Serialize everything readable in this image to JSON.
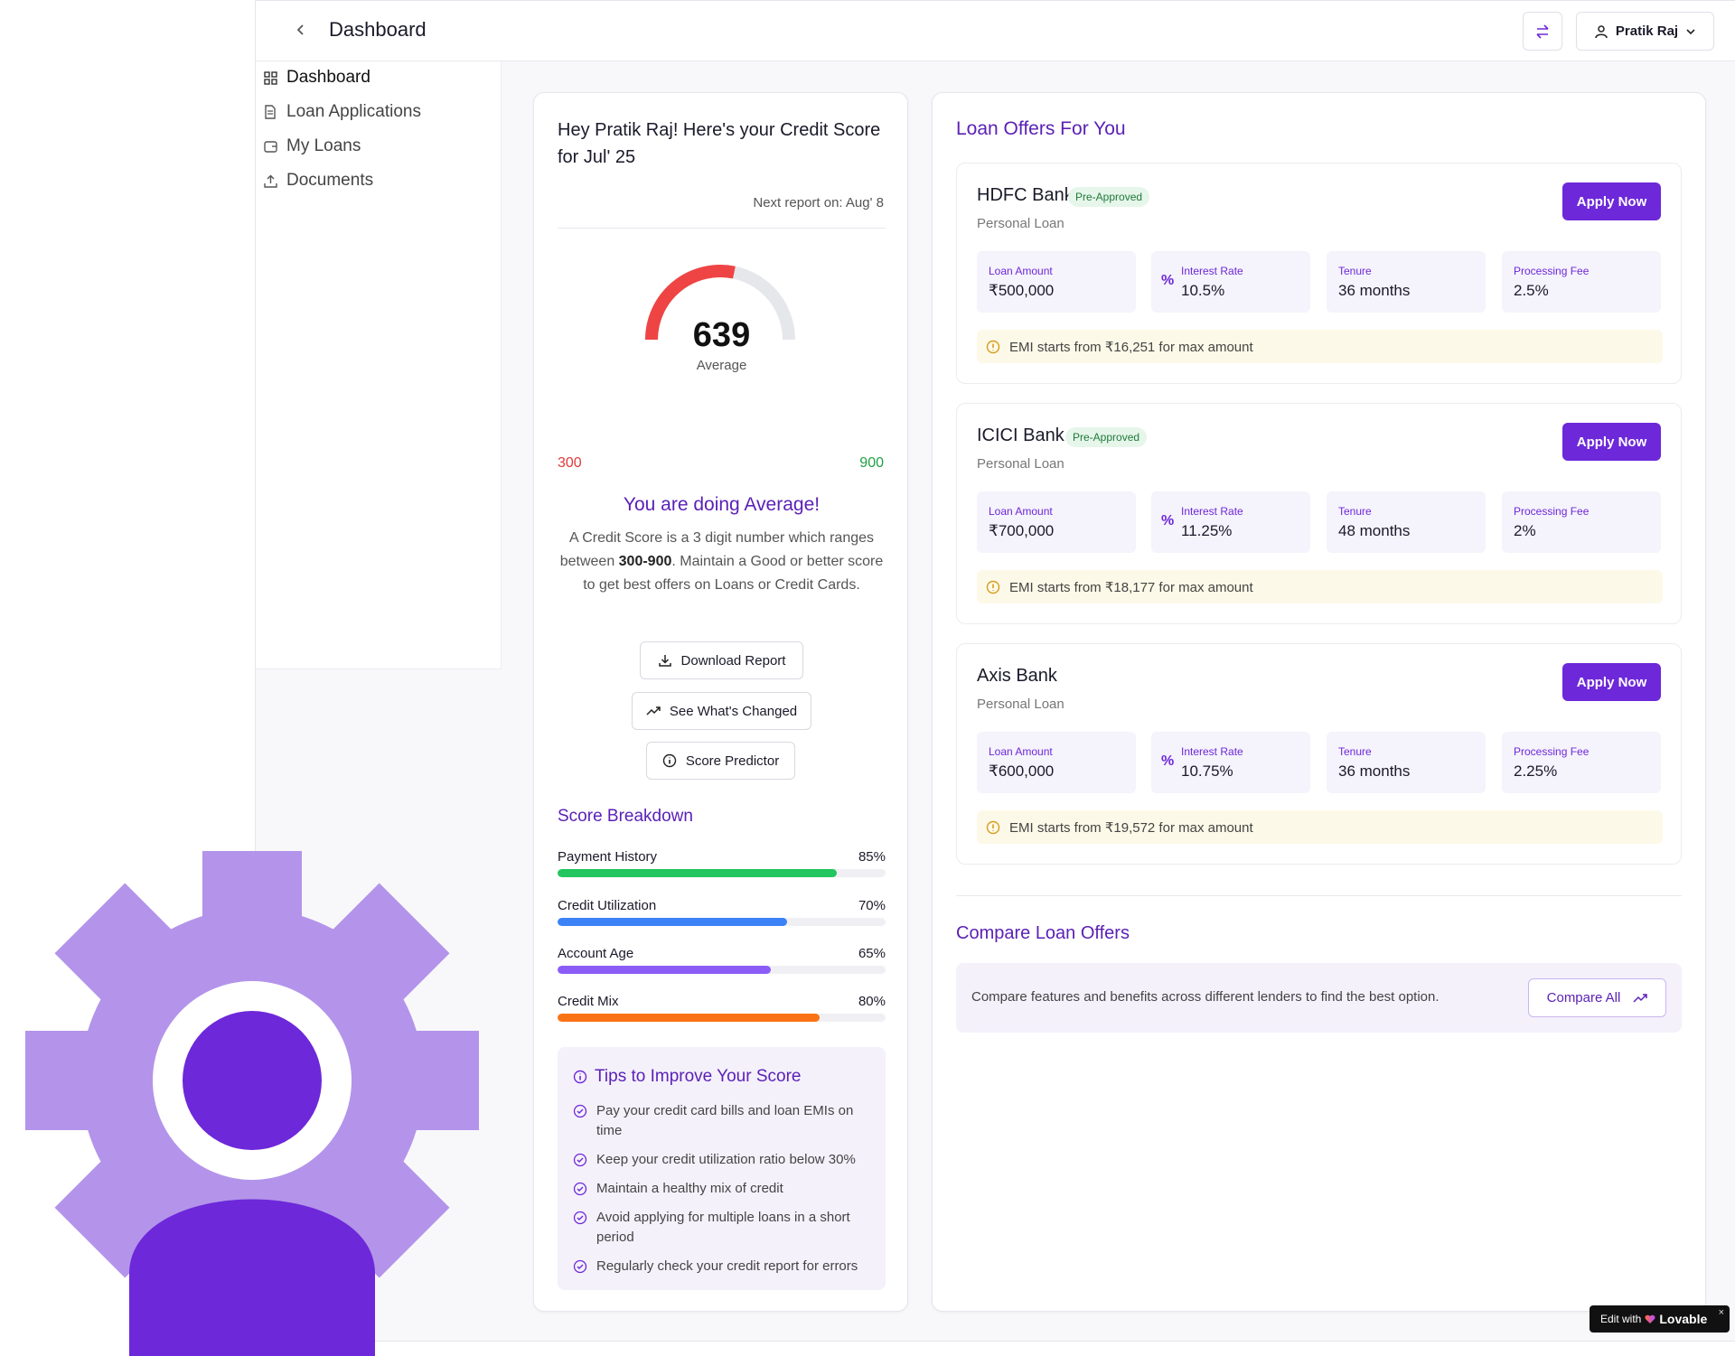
{
  "header": {
    "title": "Dashboard",
    "user_name": "Pratik Raj"
  },
  "sidebar": {
    "items": [
      {
        "label": "Dashboard",
        "icon": "grid-icon"
      },
      {
        "label": "Loan Applications",
        "icon": "file-icon"
      },
      {
        "label": "My Loans",
        "icon": "wallet-icon"
      },
      {
        "label": "Documents",
        "icon": "upload-icon"
      }
    ]
  },
  "credit": {
    "title": "Hey Pratik Raj! Here's your Credit Score for Jul' 25",
    "next_report": "Next report on: Aug' 8",
    "score": "639",
    "score_value": 639,
    "score_label": "Average",
    "range_min": "300",
    "range_max": "900",
    "status": "You are doing Average!",
    "desc_1": "A Credit Score is a 3 digit number which ranges between ",
    "desc_bold": "300-900",
    "desc_2": ". Maintain a Good or better score to get best offers on Loans or Credit Cards.",
    "buttons": {
      "download": "Download Report",
      "changed": "See What's Changed",
      "predictor": "Score Predictor"
    },
    "colors": {
      "gauge_fill": "#ef4444",
      "gauge_track": "#e5e7eb"
    }
  },
  "breakdown": {
    "title": "Score Breakdown",
    "items": [
      {
        "label": "Payment History",
        "pct": "85%",
        "value": 85,
        "color": "#22c55e"
      },
      {
        "label": "Credit Utilization",
        "pct": "70%",
        "value": 70,
        "color": "#3b82f6"
      },
      {
        "label": "Account Age",
        "pct": "65%",
        "value": 65,
        "color": "#8b5cf6"
      },
      {
        "label": "Credit Mix",
        "pct": "80%",
        "value": 80,
        "color": "#f97316"
      }
    ]
  },
  "tips": {
    "title": "Tips to Improve Your Score",
    "items": [
      "Pay your credit card bills and loan EMIs on time",
      "Keep your credit utilization ratio below 30%",
      "Maintain a healthy mix of credit",
      "Avoid applying for multiple loans in a short period",
      "Regularly check your credit report for errors"
    ]
  },
  "offers": {
    "title": "Loan Offers For You",
    "apply_label": "Apply Now",
    "labels": {
      "amount": "Loan Amount",
      "rate": "Interest Rate",
      "tenure": "Tenure",
      "fee": "Processing Fee"
    },
    "items": [
      {
        "bank": "HDFC Bank",
        "badge": "Pre-Approved",
        "type": "Personal Loan",
        "amount": "₹500,000",
        "rate": "10.5%",
        "tenure": "36 months",
        "fee": "2.5%",
        "emi": "EMI starts from ₹16,251 for max amount"
      },
      {
        "bank": "ICICI Bank",
        "badge": "Pre-Approved",
        "type": "Personal Loan",
        "amount": "₹700,000",
        "rate": "11.25%",
        "tenure": "48 months",
        "fee": "2%",
        "emi": "EMI starts from ₹18,177 for max amount"
      },
      {
        "bank": "Axis Bank",
        "badge": "",
        "type": "Personal Loan",
        "amount": "₹600,000",
        "rate": "10.75%",
        "tenure": "36 months",
        "fee": "2.25%",
        "emi": "EMI starts from ₹19,572 for max amount"
      }
    ]
  },
  "compare": {
    "title": "Compare Loan Offers",
    "text": "Compare features and benefits across different lenders to find the best option.",
    "button": "Compare All"
  },
  "badge_lovable": {
    "prefix": "Edit with",
    "brand": "Lovable",
    "close": "×"
  },
  "theme": {
    "accent": "#6d28d9",
    "accent_text": "#5b21b6"
  }
}
